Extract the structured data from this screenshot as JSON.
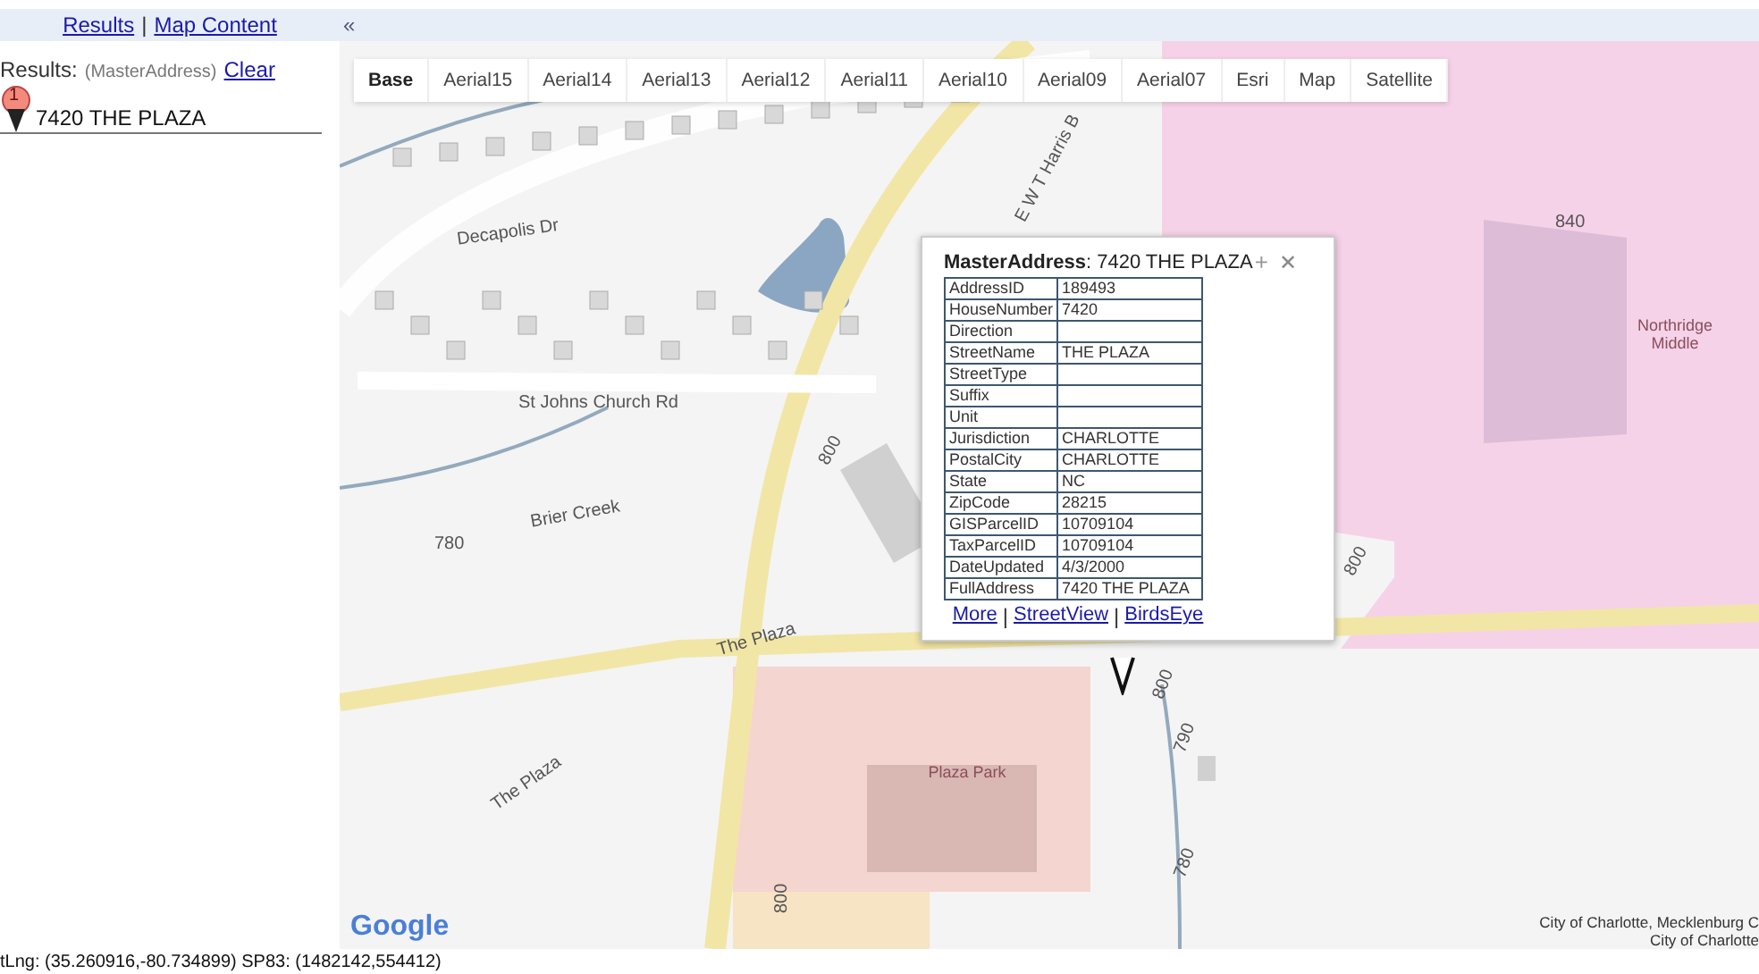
{
  "top_bar": {
    "links": [
      {
        "label": "Results"
      },
      {
        "label": "Map Content"
      }
    ],
    "separator": "|",
    "collapse": "«"
  },
  "results_panel": {
    "heading": "Results:",
    "layer": "(MasterAddress)",
    "clear": "Clear",
    "items": [
      {
        "number": "1",
        "label": "7420 THE PLAZA"
      }
    ]
  },
  "basemap_tabs": [
    {
      "label": "Base",
      "selected": true
    },
    {
      "label": "Aerial15",
      "selected": false
    },
    {
      "label": "Aerial14",
      "selected": false
    },
    {
      "label": "Aerial13",
      "selected": false
    },
    {
      "label": "Aerial12",
      "selected": false
    },
    {
      "label": "Aerial11",
      "selected": false
    },
    {
      "label": "Aerial10",
      "selected": false
    },
    {
      "label": "Aerial09",
      "selected": false
    },
    {
      "label": "Aerial07",
      "selected": false
    },
    {
      "label": "Esri",
      "selected": false
    },
    {
      "label": "Map",
      "selected": false
    },
    {
      "label": "Satellite",
      "selected": false
    }
  ],
  "map_labels": [
    {
      "text": "E W T Harris B"
    },
    {
      "text": "Decapolis Dr"
    },
    {
      "text": "St Johns Church Rd"
    },
    {
      "text": "Brier Creek"
    },
    {
      "text": "780"
    },
    {
      "text": "800"
    },
    {
      "text": "The Plaza"
    },
    {
      "text": "The Plaza"
    },
    {
      "text": "Plaza Park"
    },
    {
      "text": "Northridge Middle"
    },
    {
      "text": "840"
    },
    {
      "text": "800"
    },
    {
      "text": "800"
    },
    {
      "text": "790"
    },
    {
      "text": "780"
    },
    {
      "text": "800"
    }
  ],
  "popup": {
    "layer": "MasterAddress",
    "title": ": 7420 THE PLAZA",
    "zoom": "+",
    "close": "✕",
    "rows": [
      {
        "field": "AddressID",
        "value": "189493"
      },
      {
        "field": "HouseNumber",
        "value": "7420"
      },
      {
        "field": "Direction",
        "value": ""
      },
      {
        "field": "StreetName",
        "value": "THE PLAZA"
      },
      {
        "field": "StreetType",
        "value": ""
      },
      {
        "field": "Suffix",
        "value": ""
      },
      {
        "field": "Unit",
        "value": ""
      },
      {
        "field": "Jurisdiction",
        "value": "CHARLOTTE"
      },
      {
        "field": "PostalCity",
        "value": "CHARLOTTE"
      },
      {
        "field": "State",
        "value": "NC"
      },
      {
        "field": "ZipCode",
        "value": "28215"
      },
      {
        "field": "GISParcelID",
        "value": "10709104"
      },
      {
        "field": "TaxParcelID",
        "value": "10709104"
      },
      {
        "field": "DateUpdated",
        "value": "4/3/2000"
      },
      {
        "field": "FullAddress",
        "value": "7420 THE PLAZA"
      }
    ],
    "links": [
      {
        "label": "More"
      },
      {
        "label": "StreetView"
      },
      {
        "label": "BirdsEye"
      }
    ],
    "separator": "|"
  },
  "logo": "Google",
  "attribution": [
    "City of Charlotte, Mecklenburg C",
    "City of Charlotte"
  ],
  "status_bar": "tLng: (35.260916,-80.734899) SP83: (1482142,554412)"
}
